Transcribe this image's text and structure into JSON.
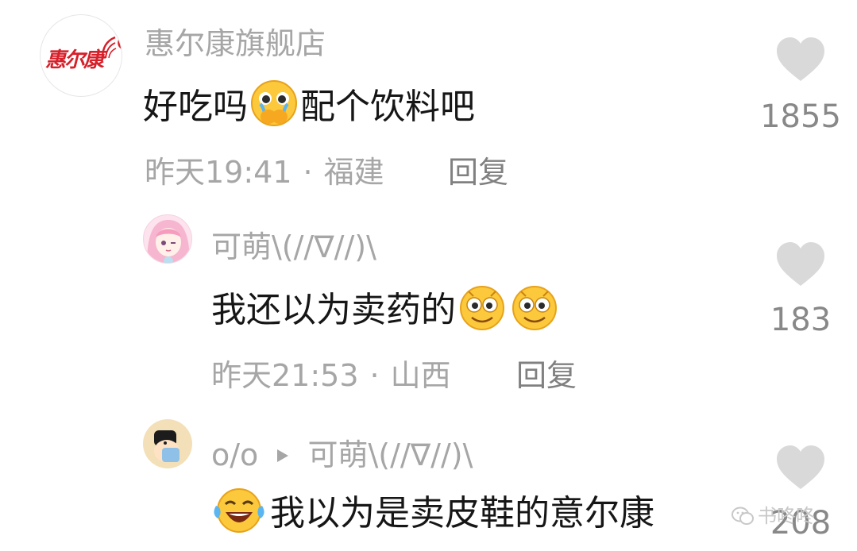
{
  "comments": [
    {
      "author": "惠尔康旗舰店",
      "avatar_logo": "惠尔康",
      "text_before": "好吃吗",
      "emoji": "pleading-hands-face",
      "text_after": "配个饮料吧",
      "time": "昨天19:41",
      "location": "福建",
      "reply_label": "回复",
      "likes": "1855"
    },
    {
      "author": "可萌\\(//∇//)\\",
      "text": "我还以为卖药的",
      "emoji": "smiling-face",
      "time": "昨天21:53",
      "location": "山西",
      "reply_label": "回复",
      "likes": "183"
    },
    {
      "author": "o/o",
      "reply_to": "可萌\\(//∇//)\\",
      "emoji": "laughing-tears-face",
      "text": "我以为是卖皮鞋的意尔康",
      "likes": "208"
    }
  ],
  "dot_separator": "·",
  "watermark": "书咚咚",
  "colors": {
    "name": "#a6a6a6",
    "text": "#161616",
    "meta": "#a6a6a6",
    "heart": "#d9d9d9",
    "brand_red": "#d6202a"
  }
}
